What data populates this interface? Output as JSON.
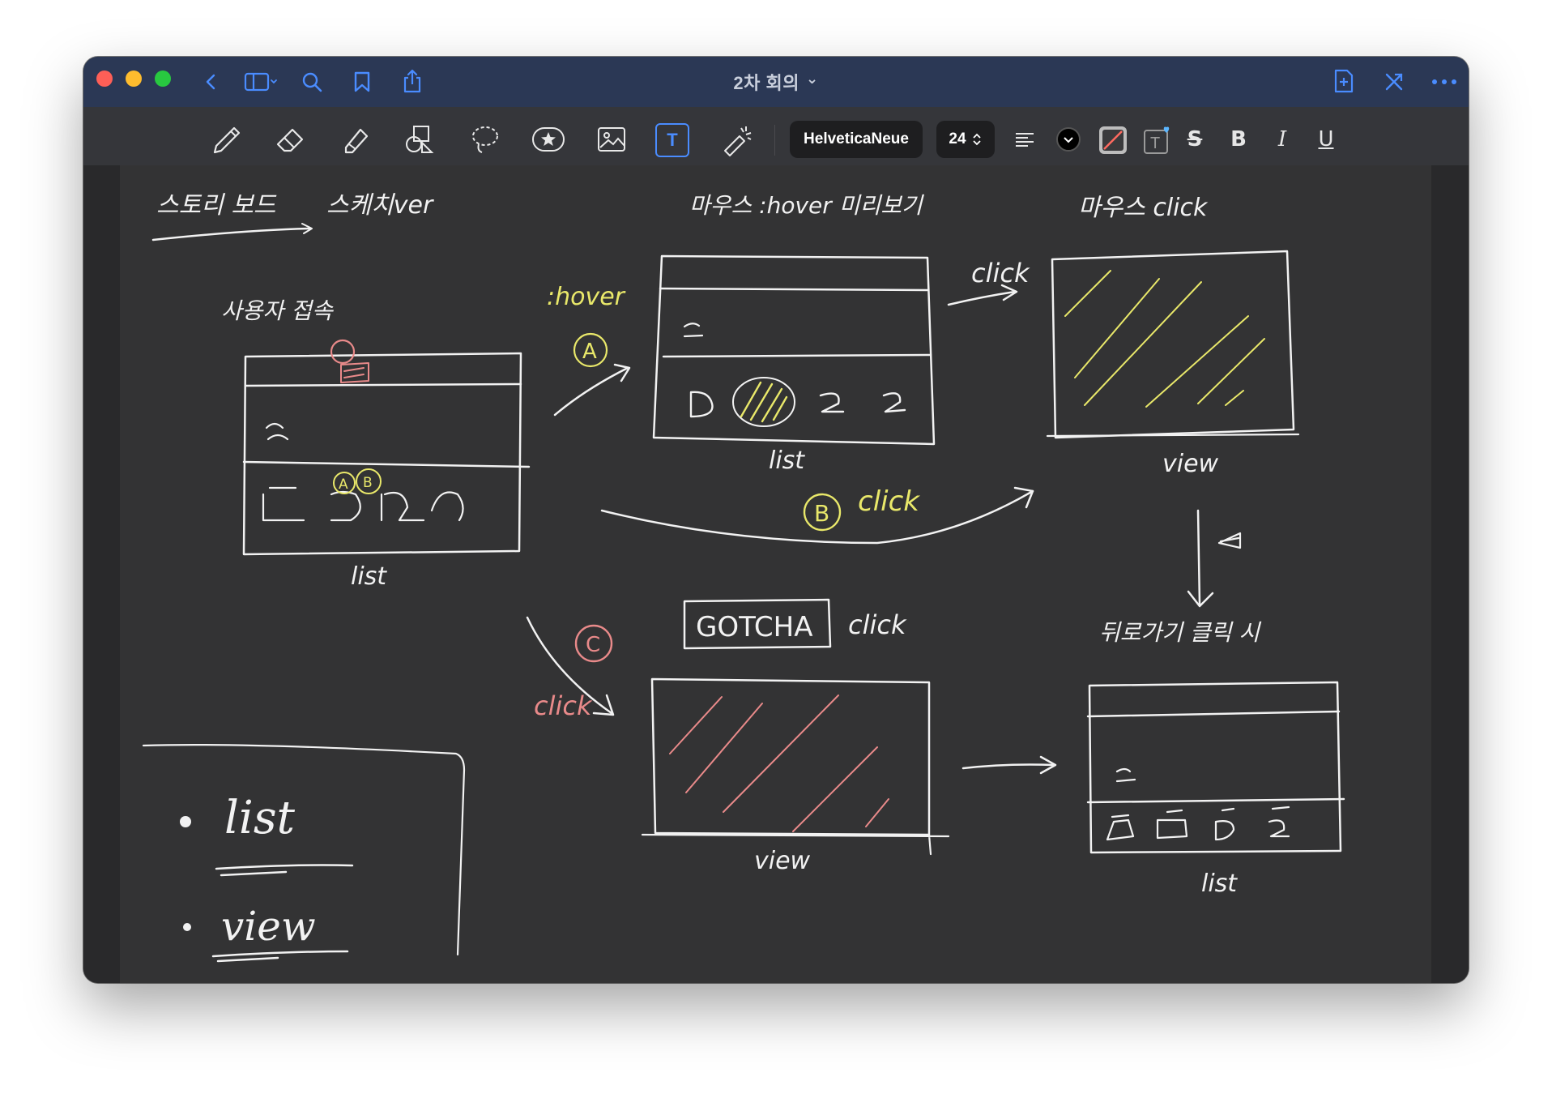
{
  "window": {
    "title": "2차 회의",
    "title_chevron": "⌄"
  },
  "toolbar": {
    "font_name": "HelveticaNeue",
    "font_size": "24",
    "bold_label": "B",
    "italic_label": "I",
    "underline_label": "U",
    "strike_label": "S",
    "text_tool_label": "T"
  },
  "colors": {
    "titlebar": "#2b3855",
    "accent": "#4a8cff",
    "ink_white": "#f2f2f2",
    "ink_yellow": "#e9e86a",
    "ink_pink": "#e98a8a"
  },
  "sketch": {
    "header_left": "스토리 보드",
    "header_left2": "스케치ver",
    "user_access": "사용자 접속",
    "hover_label": ":hover",
    "hover_preview": "마우스 :hover 미리보기",
    "mouse_click": "마우스 click",
    "click_1": "click",
    "click_b": "click",
    "click_c": "click",
    "gotcha": "GOTCHA",
    "gotcha_click": "click",
    "back_button": "뒤로가기 클릭 시",
    "list_1": "list",
    "list_2": "list",
    "list_3": "list",
    "view_1": "view",
    "view_2": "view",
    "legend_list": "list",
    "legend_view": "view",
    "badge_a": "A",
    "badge_b": "B",
    "badge_c": "C"
  }
}
